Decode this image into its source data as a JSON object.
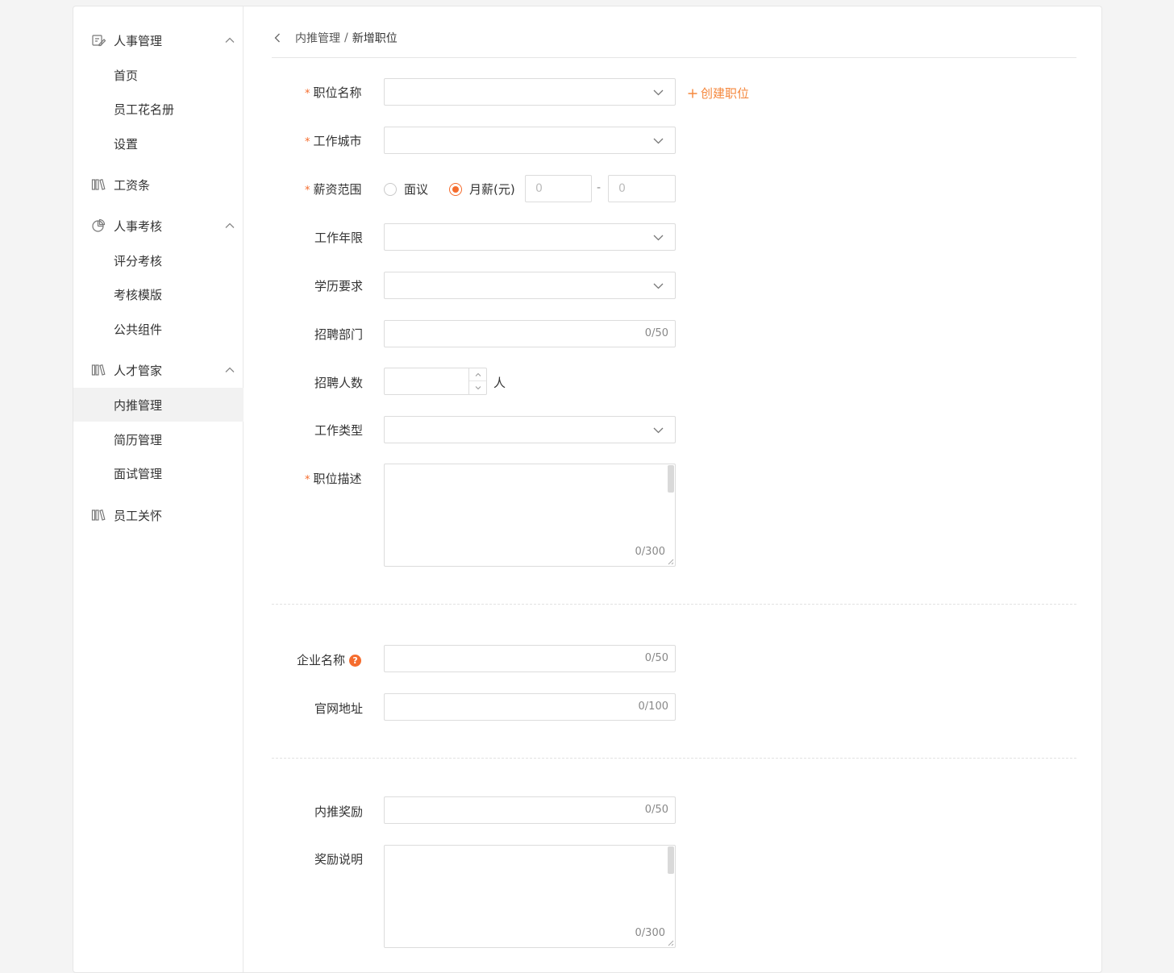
{
  "sidebar": {
    "groups": [
      {
        "label": "人事管理",
        "icon": "edit-icon",
        "expanded": true,
        "items": [
          "首页",
          "员工花名册",
          "设置"
        ]
      },
      {
        "label": "工资条",
        "icon": "books-icon",
        "expanded": false,
        "items": []
      },
      {
        "label": "人事考核",
        "icon": "pie-chart-icon",
        "expanded": true,
        "items": [
          "评分考核",
          "考核模版",
          "公共组件"
        ]
      },
      {
        "label": "人才管家",
        "icon": "books-icon",
        "expanded": true,
        "items": [
          "内推管理",
          "简历管理",
          "面试管理"
        ]
      },
      {
        "label": "员工关怀",
        "icon": "books-icon",
        "expanded": false,
        "items": []
      }
    ],
    "active_item": "内推管理"
  },
  "breadcrumb": {
    "parent": "内推管理",
    "separator": "/",
    "current": "新增职位"
  },
  "form": {
    "required_mark": "*",
    "position_name": {
      "label": "职位名称",
      "value": ""
    },
    "create_position_link": "创建职位",
    "work_city": {
      "label": "工作城市",
      "value": ""
    },
    "salary": {
      "label": "薪资范围",
      "option_negotiable": "面议",
      "option_monthly": "月薪(元)",
      "selected": "月薪(元)",
      "min_placeholder": "0",
      "separator": "-",
      "max_placeholder": "0"
    },
    "work_years": {
      "label": "工作年限",
      "value": ""
    },
    "education": {
      "label": "学历要求",
      "value": ""
    },
    "department": {
      "label": "招聘部门",
      "value": "",
      "counter": "0/50"
    },
    "headcount": {
      "label": "招聘人数",
      "value": "",
      "unit": "人"
    },
    "work_type": {
      "label": "工作类型",
      "value": ""
    },
    "description": {
      "label": "职位描述",
      "value": "",
      "counter": "0/300"
    },
    "company_name": {
      "label": "企业名称",
      "help": "?",
      "value": "",
      "counter": "0/50"
    },
    "website": {
      "label": "官网地址",
      "value": "",
      "counter": "0/100"
    },
    "referral_reward": {
      "label": "内推奖励",
      "value": "",
      "counter": "0/50"
    },
    "reward_note": {
      "label": "奖励说明",
      "value": "",
      "counter": "0/300"
    }
  },
  "colors": {
    "accent": "#f56c2d",
    "link": "#f5873c",
    "active_bg": "#f2f2f2",
    "border": "#dcdcdc"
  }
}
